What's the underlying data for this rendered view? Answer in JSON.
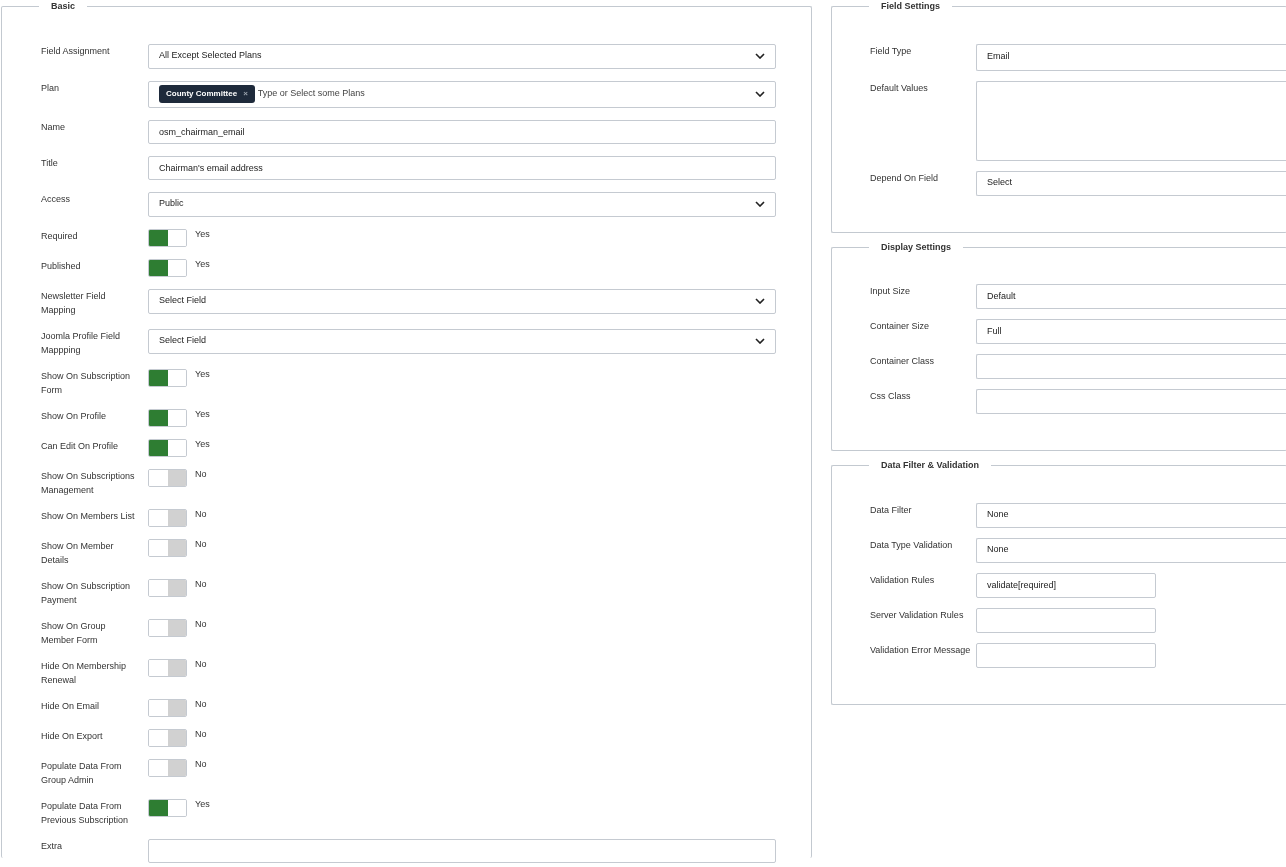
{
  "columns": [
    {
      "sections": [
        {
          "title": "Basic",
          "fields": [
            {
              "kind": "select",
              "label": "Field Assignment",
              "value": "All Except Selected Plans"
            },
            {
              "kind": "multiselect",
              "label": "Plan",
              "tags": [
                {
                  "label": "County Committee",
                  "remove": "×"
                }
              ],
              "placeholder": "Type or Select some Plans"
            },
            {
              "kind": "text",
              "label": "Name",
              "value": "osm_chairman_email"
            },
            {
              "kind": "text",
              "label": "Title",
              "value": "Chairman's email address"
            },
            {
              "kind": "select",
              "label": "Access",
              "value": "Public"
            },
            {
              "kind": "toggle",
              "label": "Required",
              "on": true,
              "state_label": "Yes"
            },
            {
              "kind": "toggle",
              "label": "Published",
              "on": true,
              "state_label": "Yes"
            },
            {
              "kind": "select",
              "label": "Newsletter Field Mapping",
              "value": "Select Field"
            },
            {
              "kind": "select",
              "label": "Joomla Profile Field Mappping",
              "value": "Select Field"
            },
            {
              "kind": "toggle",
              "label": "Show On Subscription Form",
              "on": true,
              "state_label": "Yes"
            },
            {
              "kind": "toggle",
              "label": "Show On Profile",
              "on": true,
              "state_label": "Yes"
            },
            {
              "kind": "toggle",
              "label": "Can Edit On Profile",
              "on": true,
              "state_label": "Yes"
            },
            {
              "kind": "toggle",
              "label": "Show On Subscriptions Management",
              "on": false,
              "state_label": "No"
            },
            {
              "kind": "toggle",
              "label": "Show On Members List",
              "on": false,
              "state_label": "No"
            },
            {
              "kind": "toggle",
              "label": "Show On Member Details",
              "on": false,
              "state_label": "No"
            },
            {
              "kind": "toggle",
              "label": "Show On Subscription Payment",
              "on": false,
              "state_label": "No"
            },
            {
              "kind": "toggle",
              "label": "Show On Group Member Form",
              "on": false,
              "state_label": "No"
            },
            {
              "kind": "toggle",
              "label": "Hide On Membership Renewal",
              "on": false,
              "state_label": "No"
            },
            {
              "kind": "toggle",
              "label": "Hide On Email",
              "on": false,
              "state_label": "No"
            },
            {
              "kind": "toggle",
              "label": "Hide On Export",
              "on": false,
              "state_label": "No"
            },
            {
              "kind": "toggle",
              "label": "Populate Data From Group Admin",
              "on": false,
              "state_label": "No"
            },
            {
              "kind": "toggle",
              "label": "Populate Data From Previous Subscription",
              "on": true,
              "state_label": "Yes"
            },
            {
              "kind": "text",
              "label": "Extra"
            }
          ]
        }
      ]
    },
    {
      "sections": [
        {
          "title": "Field Settings",
          "fields": [
            {
              "kind": "select",
              "label": "Field Type",
              "value": "Email"
            },
            {
              "kind": "textarea",
              "label": "Default Values"
            },
            {
              "kind": "select",
              "label": "Depend On Field",
              "value": "Select"
            }
          ]
        },
        {
          "title": "Display Settings",
          "fields": [
            {
              "kind": "select",
              "label": "Input Size",
              "value": "Default"
            },
            {
              "kind": "select",
              "label": "Container Size",
              "value": "Full"
            },
            {
              "kind": "wide",
              "label": "Container Class"
            },
            {
              "kind": "wide",
              "label": "Css Class"
            }
          ]
        },
        {
          "title": "Data Filter & Validation",
          "fields": [
            {
              "kind": "select",
              "label": "Data Filter",
              "value": "None"
            },
            {
              "kind": "select",
              "label": "Data Type Validation",
              "value": "None"
            },
            {
              "kind": "short",
              "label": "Validation Rules",
              "value": "validate[required]"
            },
            {
              "kind": "short",
              "label": "Server Validation Rules"
            },
            {
              "kind": "short",
              "label": "Validation Error Message"
            }
          ]
        }
      ]
    }
  ]
}
